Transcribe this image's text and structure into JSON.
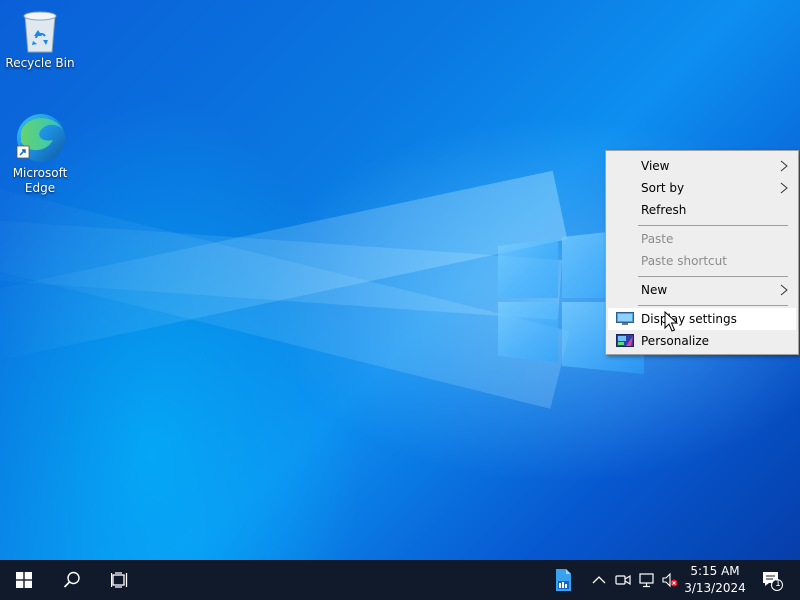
{
  "desktop": {
    "icons": [
      {
        "label": "Recycle Bin",
        "icon": "recycle-bin-icon"
      },
      {
        "label": "Microsoft Edge",
        "icon": "edge-icon"
      }
    ]
  },
  "context_menu": {
    "items": [
      {
        "label": "View",
        "submenu": true,
        "enabled": true
      },
      {
        "label": "Sort by",
        "submenu": true,
        "enabled": true
      },
      {
        "label": "Refresh",
        "submenu": false,
        "enabled": true
      },
      {
        "label": "Paste",
        "submenu": false,
        "enabled": false
      },
      {
        "label": "Paste shortcut",
        "submenu": false,
        "enabled": false
      },
      {
        "label": "New",
        "submenu": true,
        "enabled": true
      },
      {
        "label": "Display settings",
        "submenu": false,
        "enabled": true,
        "icon": "display-icon",
        "hovered": true
      },
      {
        "label": "Personalize",
        "submenu": false,
        "enabled": true,
        "icon": "personalize-icon"
      }
    ]
  },
  "taskbar": {
    "start": "windows-start-icon",
    "search": "search-icon",
    "task_view": "task-view-icon",
    "pinned": "blue-app-icon",
    "tray": [
      "chevron-up-icon",
      "meet-now-icon",
      "network-icon",
      "volume-muted-icon"
    ],
    "clock": {
      "time": "5:15 AM",
      "date": "3/13/2024"
    },
    "notifications": {
      "icon": "notification-icon",
      "count": "1"
    }
  },
  "colors": {
    "taskbar": "#101a2a",
    "menu_bg": "#eeeeee",
    "menu_disabled": "#8c8c8c",
    "accent": "#0078d7"
  }
}
